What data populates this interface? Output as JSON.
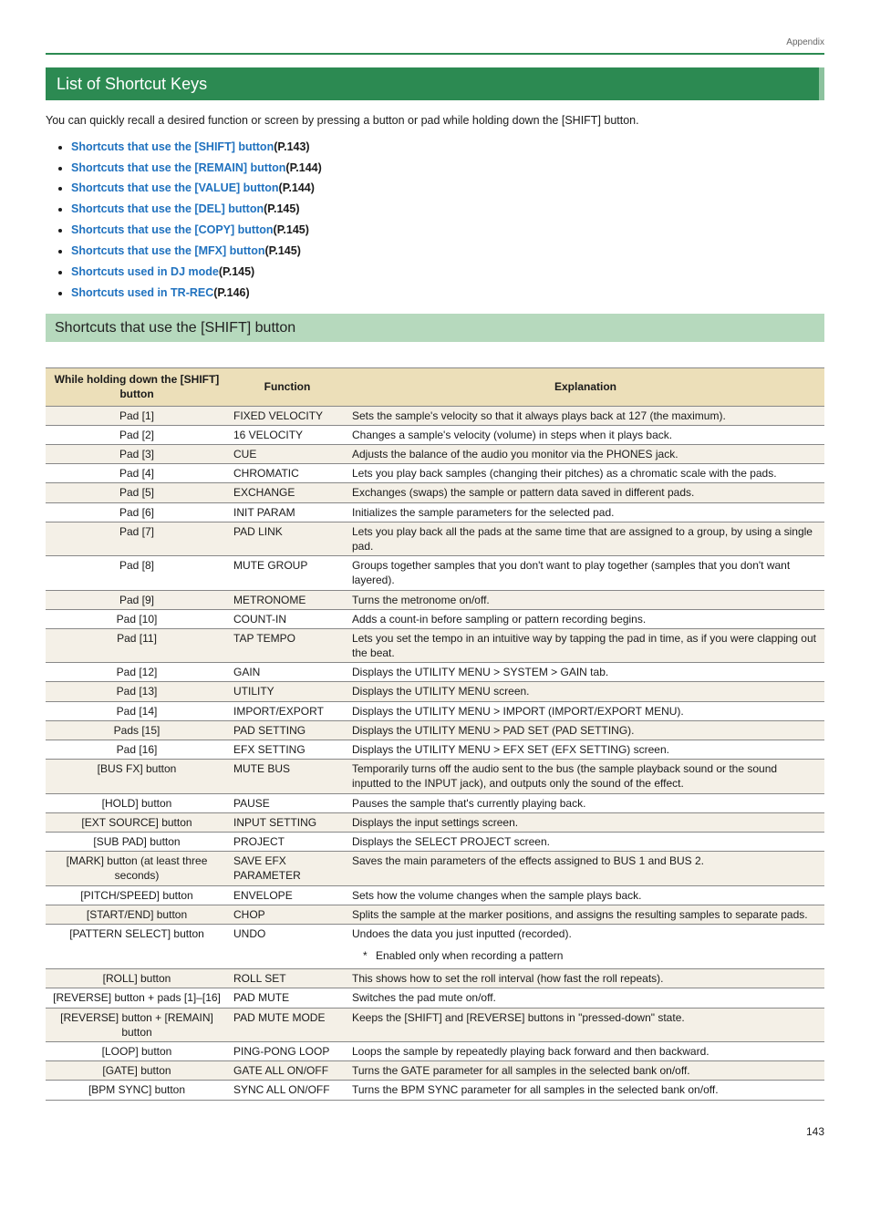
{
  "header": {
    "appendix": "Appendix"
  },
  "section": {
    "title": "List of Shortcut Keys",
    "intro": "You can quickly recall a desired function or screen by pressing a button or pad while holding down the [SHIFT] button.",
    "links": [
      {
        "text": "Shortcuts that use the [SHIFT] button",
        "page": "(P.143)"
      },
      {
        "text": "Shortcuts that use the [REMAIN] button",
        "page": "(P.144)"
      },
      {
        "text": "Shortcuts that use the [VALUE] button",
        "page": "(P.144)"
      },
      {
        "text": "Shortcuts that use the [DEL] button",
        "page": "(P.145)"
      },
      {
        "text": "Shortcuts that use the [COPY] button",
        "page": "(P.145)"
      },
      {
        "text": "Shortcuts that use the [MFX] button",
        "page": "(P.145)"
      },
      {
        "text": "Shortcuts used in DJ mode",
        "page": "(P.145)"
      },
      {
        "text": "Shortcuts used in TR-REC",
        "page": "(P.146)"
      }
    ],
    "subsection_title": "Shortcuts that use the [SHIFT] button"
  },
  "table": {
    "headers": {
      "key": "While holding down the [SHIFT] button",
      "func": "Function",
      "expl": "Explanation"
    },
    "rows": [
      {
        "key": "Pad [1]",
        "func": "FIXED VELOCITY",
        "expl": "Sets the sample's velocity so that it always plays back at 127 (the maximum)."
      },
      {
        "key": "Pad [2]",
        "func": "16 VELOCITY",
        "expl": "Changes a sample's velocity (volume) in steps when it plays back."
      },
      {
        "key": "Pad [3]",
        "func": "CUE",
        "expl": "Adjusts the balance of the audio you monitor via the PHONES jack."
      },
      {
        "key": "Pad [4]",
        "func": "CHROMATIC",
        "expl": "Lets you play back samples (changing their pitches) as a chromatic scale with the pads."
      },
      {
        "key": "Pad [5]",
        "func": "EXCHANGE",
        "expl": "Exchanges (swaps) the sample or pattern data saved in different pads."
      },
      {
        "key": "Pad [6]",
        "func": "INIT PARAM",
        "expl": "Initializes the sample parameters for the selected pad."
      },
      {
        "key": "Pad [7]",
        "func": "PAD LINK",
        "expl": "Lets you play back all the pads at the same time that are assigned to a group, by using a single pad."
      },
      {
        "key": "Pad [8]",
        "func": "MUTE GROUP",
        "expl": "Groups together samples that you don't want to play together (samples that you don't want layered)."
      },
      {
        "key": "Pad [9]",
        "func": "METRONOME",
        "expl": "Turns the metronome on/off."
      },
      {
        "key": "Pad [10]",
        "func": "COUNT-IN",
        "expl": "Adds a count-in before sampling or pattern recording begins."
      },
      {
        "key": "Pad [11]",
        "func": "TAP TEMPO",
        "expl": "Lets you set the tempo in an intuitive way by tapping the pad in time, as if you were clapping out the beat."
      },
      {
        "key": "Pad [12]",
        "func": "GAIN",
        "expl": "Displays the UTILITY MENU > SYSTEM > GAIN tab."
      },
      {
        "key": "Pad [13]",
        "func": "UTILITY",
        "expl": "Displays the UTILITY MENU screen."
      },
      {
        "key": "Pad [14]",
        "func": "IMPORT/EXPORT",
        "expl": "Displays the UTILITY MENU > IMPORT (IMPORT/EXPORT MENU)."
      },
      {
        "key": "Pads [15]",
        "func": "PAD SETTING",
        "expl": "Displays the UTILITY MENU > PAD SET (PAD SETTING)."
      },
      {
        "key": "Pad [16]",
        "func": "EFX SETTING",
        "expl": "Displays the UTILITY MENU > EFX SET (EFX SETTING) screen."
      },
      {
        "key": "[BUS FX] button",
        "func": "MUTE BUS",
        "expl": "Temporarily turns off the audio sent to the bus (the sample playback sound or the sound inputted to the INPUT jack), and outputs only the sound of the effect."
      },
      {
        "key": "[HOLD] button",
        "func": "PAUSE",
        "expl": "Pauses the sample that's currently playing back."
      },
      {
        "key": "[EXT SOURCE] button",
        "func": "INPUT SETTING",
        "expl": "Displays the input settings screen."
      },
      {
        "key": "[SUB PAD] button",
        "func": "PROJECT",
        "expl": "Displays the SELECT PROJECT screen."
      },
      {
        "key": "[MARK] button (at least three seconds)",
        "func": "SAVE EFX PARAMETER",
        "expl": "Saves the main parameters of the effects assigned to BUS 1 and BUS 2."
      },
      {
        "key": "[PITCH/SPEED] button",
        "func": "ENVELOPE",
        "expl": "Sets how the volume changes when the sample plays back."
      },
      {
        "key": "[START/END] button",
        "func": "CHOP",
        "expl": "Splits the sample at the marker positions, and assigns the resulting samples to separate pads."
      },
      {
        "key": "[PATTERN SELECT] button",
        "func": "UNDO",
        "expl": "Undoes the data you just inputted (recorded).",
        "note": "Enabled only when recording a pattern"
      },
      {
        "key": "[ROLL] button",
        "func": "ROLL SET",
        "expl": "This shows how to set the roll interval (how fast the roll repeats)."
      },
      {
        "key": "[REVERSE] button + pads [1]–[16]",
        "func": "PAD MUTE",
        "expl": "Switches the pad mute on/off."
      },
      {
        "key": "[REVERSE] button + [REMAIN] button",
        "func": "PAD MUTE MODE",
        "expl": "Keeps the [SHIFT] and [REVERSE] buttons in \"pressed-down\" state."
      },
      {
        "key": "[LOOP] button",
        "func": "PING-PONG LOOP",
        "expl": "Loops the sample by repeatedly playing back forward and then backward."
      },
      {
        "key": "[GATE] button",
        "func": "GATE ALL ON/OFF",
        "expl": "Turns the GATE parameter for all samples in the selected bank on/off."
      },
      {
        "key": "[BPM SYNC] button",
        "func": "SYNC ALL ON/OFF",
        "expl": "Turns the BPM SYNC parameter for all samples in the selected bank on/off."
      }
    ]
  },
  "footer": {
    "page_number": "143"
  },
  "chart_data": {
    "type": "table",
    "title": "Shortcuts that use the [SHIFT] button",
    "columns": [
      "While holding down the [SHIFT] button",
      "Function",
      "Explanation"
    ],
    "rows": [
      [
        "Pad [1]",
        "FIXED VELOCITY",
        "Sets the sample's velocity so that it always plays back at 127 (the maximum)."
      ],
      [
        "Pad [2]",
        "16 VELOCITY",
        "Changes a sample's velocity (volume) in steps when it plays back."
      ],
      [
        "Pad [3]",
        "CUE",
        "Adjusts the balance of the audio you monitor via the PHONES jack."
      ],
      [
        "Pad [4]",
        "CHROMATIC",
        "Lets you play back samples (changing their pitches) as a chromatic scale with the pads."
      ],
      [
        "Pad [5]",
        "EXCHANGE",
        "Exchanges (swaps) the sample or pattern data saved in different pads."
      ],
      [
        "Pad [6]",
        "INIT PARAM",
        "Initializes the sample parameters for the selected pad."
      ],
      [
        "Pad [7]",
        "PAD LINK",
        "Lets you play back all the pads at the same time that are assigned to a group, by using a single pad."
      ],
      [
        "Pad [8]",
        "MUTE GROUP",
        "Groups together samples that you don't want to play together (samples that you don't want layered)."
      ],
      [
        "Pad [9]",
        "METRONOME",
        "Turns the metronome on/off."
      ],
      [
        "Pad [10]",
        "COUNT-IN",
        "Adds a count-in before sampling or pattern recording begins."
      ],
      [
        "Pad [11]",
        "TAP TEMPO",
        "Lets you set the tempo in an intuitive way by tapping the pad in time, as if you were clapping out the beat."
      ],
      [
        "Pad [12]",
        "GAIN",
        "Displays the UTILITY MENU > SYSTEM > GAIN tab."
      ],
      [
        "Pad [13]",
        "UTILITY",
        "Displays the UTILITY MENU screen."
      ],
      [
        "Pad [14]",
        "IMPORT/EXPORT",
        "Displays the UTILITY MENU > IMPORT (IMPORT/EXPORT MENU)."
      ],
      [
        "Pads [15]",
        "PAD SETTING",
        "Displays the UTILITY MENU > PAD SET (PAD SETTING)."
      ],
      [
        "Pad [16]",
        "EFX SETTING",
        "Displays the UTILITY MENU > EFX SET (EFX SETTING) screen."
      ],
      [
        "[BUS FX] button",
        "MUTE BUS",
        "Temporarily turns off the audio sent to the bus (the sample playback sound or the sound inputted to the INPUT jack), and outputs only the sound of the effect."
      ],
      [
        "[HOLD] button",
        "PAUSE",
        "Pauses the sample that's currently playing back."
      ],
      [
        "[EXT SOURCE] button",
        "INPUT SETTING",
        "Displays the input settings screen."
      ],
      [
        "[SUB PAD] button",
        "PROJECT",
        "Displays the SELECT PROJECT screen."
      ],
      [
        "[MARK] button (at least three seconds)",
        "SAVE EFX PARAMETER",
        "Saves the main parameters of the effects assigned to BUS 1 and BUS 2."
      ],
      [
        "[PITCH/SPEED] button",
        "ENVELOPE",
        "Sets how the volume changes when the sample plays back."
      ],
      [
        "[START/END] button",
        "CHOP",
        "Splits the sample at the marker positions, and assigns the resulting samples to separate pads."
      ],
      [
        "[PATTERN SELECT] button",
        "UNDO",
        "Undoes the data you just inputted (recorded). * Enabled only when recording a pattern"
      ],
      [
        "[ROLL] button",
        "ROLL SET",
        "This shows how to set the roll interval (how fast the roll repeats)."
      ],
      [
        "[REVERSE] button + pads [1]–[16]",
        "PAD MUTE",
        "Switches the pad mute on/off."
      ],
      [
        "[REVERSE] button + [REMAIN] button",
        "PAD MUTE MODE",
        "Keeps the [SHIFT] and [REVERSE] buttons in \"pressed-down\" state."
      ],
      [
        "[LOOP] button",
        "PING-PONG LOOP",
        "Loops the sample by repeatedly playing back forward and then backward."
      ],
      [
        "[GATE] button",
        "GATE ALL ON/OFF",
        "Turns the GATE parameter for all samples in the selected bank on/off."
      ],
      [
        "[BPM SYNC] button",
        "SYNC ALL ON/OFF",
        "Turns the BPM SYNC parameter for all samples in the selected bank on/off."
      ]
    ]
  }
}
